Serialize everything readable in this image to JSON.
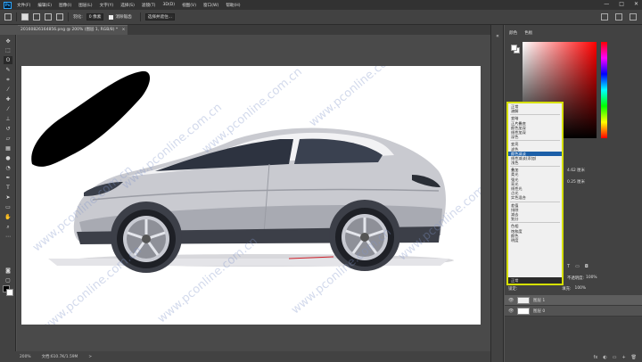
{
  "menu": {
    "logo": "Ps",
    "items": [
      "文件(F)",
      "编辑(E)",
      "图像(I)",
      "图层(L)",
      "文字(Y)",
      "选择(S)",
      "滤镜(T)",
      "3D(D)",
      "视图(V)",
      "窗口(W)",
      "帮助(H)"
    ],
    "window_controls": [
      "—",
      "□",
      "✕"
    ]
  },
  "options": {
    "feather_label": "羽化:",
    "feather_value": "0 像素",
    "antialias_label": "消除锯齿",
    "select_subject": "选择并遮住..."
  },
  "document": {
    "tab_title": "20160826164856.png @ 200% (图层 1, RGB/8) *",
    "close": "×"
  },
  "canvas": {
    "watermark": "www.pconline.com.cn"
  },
  "status": {
    "zoom": "200%",
    "doc_info": "文档:610.7K/1.59M",
    "arrow": ">"
  },
  "color_panel": {
    "tab_color": "颜色",
    "tab_swatches": "色板",
    "fg_color": "#ffffff",
    "bg_color": "#ffffff"
  },
  "blend_modes": {
    "groups": [
      [
        "正常",
        "溶解"
      ],
      [
        "变暗",
        "正片叠底",
        "颜色加深",
        "线性加深",
        "深色"
      ],
      [
        "变亮",
        "滤色",
        "颜色减淡",
        "线性减淡(添加)",
        "浅色"
      ],
      [
        "叠加",
        "柔光",
        "强光",
        "亮光",
        "线性光",
        "点光",
        "实色混合"
      ],
      [
        "差值",
        "排除",
        "减去",
        "划分"
      ],
      [
        "色相",
        "饱和度",
        "颜色",
        "明度"
      ]
    ],
    "selected": "颜色减淡",
    "current": "正常"
  },
  "properties": {
    "w_value": "4.62 厘米",
    "h_value": "0.25 厘米"
  },
  "layers": {
    "lock_label": "锁定:",
    "opacity_label": "不透明度:",
    "opacity_value": "100%",
    "fill_label": "填充:",
    "fill_value": "100%",
    "rows": [
      {
        "name": "图层 1",
        "eye": "👁"
      },
      {
        "name": "图层 0",
        "eye": "👁"
      }
    ],
    "footer_icons": [
      "fx",
      "◐",
      "▭",
      "+",
      "🗑"
    ]
  }
}
